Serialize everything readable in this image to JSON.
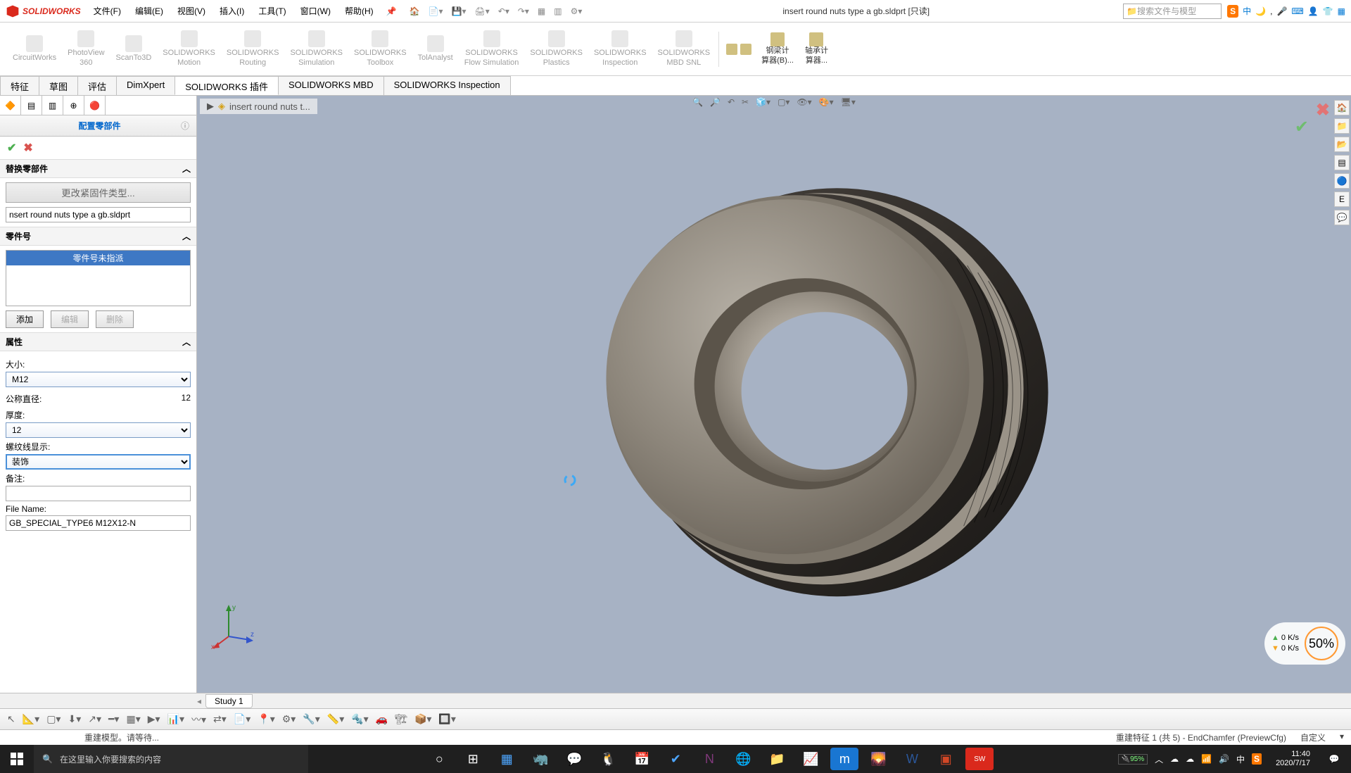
{
  "app": {
    "name": "SOLIDWORKS",
    "title": "insert round nuts type a gb.sldprt [只读]",
    "search_placeholder": "搜索文件与模型"
  },
  "menu": [
    "文件(F)",
    "编辑(E)",
    "视图(V)",
    "插入(I)",
    "工具(T)",
    "窗口(W)",
    "帮助(H)"
  ],
  "ribbon": {
    "items": [
      {
        "l1": "CircuitWorks",
        "l2": ""
      },
      {
        "l1": "PhotoView",
        "l2": "360"
      },
      {
        "l1": "ScanTo3D",
        "l2": ""
      },
      {
        "l1": "SOLIDWORKS",
        "l2": "Motion"
      },
      {
        "l1": "SOLIDWORKS",
        "l2": "Routing"
      },
      {
        "l1": "SOLIDWORKS",
        "l2": "Simulation"
      },
      {
        "l1": "SOLIDWORKS",
        "l2": "Toolbox"
      },
      {
        "l1": "TolAnalyst",
        "l2": ""
      },
      {
        "l1": "SOLIDWORKS",
        "l2": "Flow Simulation"
      },
      {
        "l1": "SOLIDWORKS",
        "l2": "Plastics"
      },
      {
        "l1": "SOLIDWORKS",
        "l2": "Inspection"
      },
      {
        "l1": "SOLIDWORKS",
        "l2": "MBD SNL"
      }
    ],
    "side": [
      {
        "label": "钢梁计",
        "sub": "算器(B)..."
      },
      {
        "label": "轴承计",
        "sub": "算器..."
      }
    ]
  },
  "tabs": [
    "特征",
    "草图",
    "评估",
    "DimXpert",
    "SOLIDWORKS 插件",
    "SOLIDWORKS MBD",
    "SOLIDWORKS Inspection"
  ],
  "breadcrumb": "insert round nuts t...",
  "panel": {
    "title": "配置零部件",
    "replace_header": "替换零部件",
    "change_type_btn": "更改紧固件类型...",
    "filename_value": "nsert round nuts type a gb.sldprt",
    "partnum_header": "零件号",
    "partnum_unassigned": "零件号未指派",
    "add_btn": "添加",
    "edit_btn": "编辑",
    "delete_btn": "删除",
    "props_header": "属性",
    "size_label": "大小:",
    "size_value": "M12",
    "nominal_label": "公称直径:",
    "nominal_value": "12",
    "thickness_label": "厚度:",
    "thickness_value": "12",
    "thread_label": "螺纹线显示:",
    "thread_value": "装饰",
    "remark_label": "备注:",
    "remark_value": "",
    "filename_label": "File Name:",
    "filename_out": "GB_SPECIAL_TYPE6 M12X12-N"
  },
  "study_tab": "Study 1",
  "status": {
    "left": "重建模型。请等待...",
    "right1": "重建特征 1 (共 5) - EndChamfer (PreviewCfg)",
    "right2": "自定义"
  },
  "speed": {
    "up": "0  K/s",
    "down": "0  K/s",
    "pct": "50%"
  },
  "taskbar": {
    "search": "在这里输入你要搜索的内容",
    "battery": "95%",
    "time": "11:40",
    "date": "2020/7/17"
  },
  "ime": "中"
}
